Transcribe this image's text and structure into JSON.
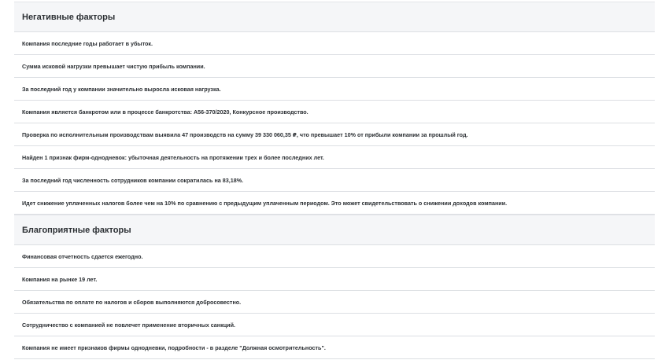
{
  "negative": {
    "title": "Негативные факторы",
    "items": [
      "Компания последние годы работает в убыток.",
      "Сумма исковой нагрузки превышает чистую прибыль компании.",
      "За последний год у компании значительно выросла исковая нагрузка.",
      "Компания является банкротом или в процессе банкротства: А56-370/2020, Конкурсное производство.",
      "Проверка по исполнительным производствам выявила 47 производств на сумму 39 330 060,35 ₽, что превышает 10% от прибыли компании за прошлый год.",
      "Найден 1 признак фирм-однодневок: убыточная деятельность на протяжении трех и более последних лет.",
      "За последний год численность сотрудников компании сократилась на 83,18%.",
      "Идет снижение уплаченных налогов более чем на 10% по сравнению с предыдущим уплаченным периодом. Это может свидетельствовать о снижении доходов компании."
    ]
  },
  "positive": {
    "title": "Благоприятные факторы",
    "items": [
      "Финансовая отчетность сдается ежегодно.",
      "Компания на рынке 19 лет.",
      "Обязательства по оплате по налогов и сборов выполняются добросовестно.",
      "Сотрудничество с компанией не повлечет применение вторичных санкций.",
      "Компания не имеет признаков фирмы однодневки, подробности - в разделе \"Должная осмотрительность\"."
    ]
  }
}
